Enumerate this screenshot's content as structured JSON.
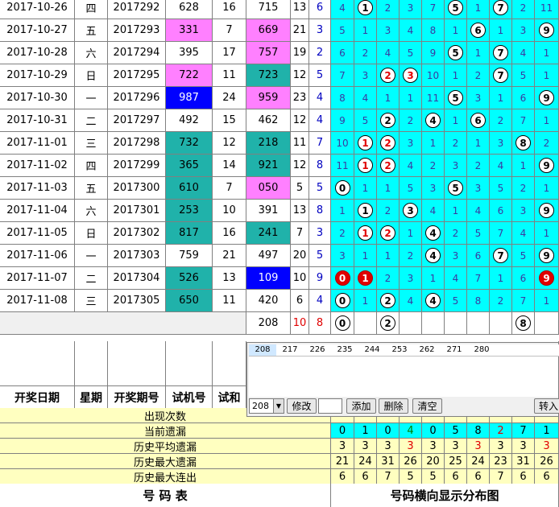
{
  "rows": [
    {
      "date": "2017-10-26",
      "wd": "四",
      "issue": "2017292",
      "test": "628",
      "tbg": "",
      "sum": "16",
      "kj": "715",
      "kbg": "",
      "s": "13",
      "sp": "6",
      "cells": [
        "4",
        "1",
        "2",
        "3",
        "7",
        "5",
        "1",
        "7",
        "2",
        "11"
      ]
    },
    {
      "date": "2017-10-27",
      "wd": "五",
      "issue": "2017293",
      "test": "331",
      "tbg": "pink",
      "sum": "7",
      "kj": "669",
      "kbg": "pink",
      "s": "21",
      "sp": "3",
      "cells": [
        "5",
        "1",
        "3",
        "4",
        "8",
        "1",
        "6",
        "1",
        "3",
        "9"
      ]
    },
    {
      "date": "2017-10-28",
      "wd": "六",
      "issue": "2017294",
      "test": "395",
      "tbg": "",
      "sum": "17",
      "kj": "757",
      "kbg": "pink",
      "s": "19",
      "sp": "2",
      "cells": [
        "6",
        "2",
        "4",
        "5",
        "9",
        "5",
        "1",
        "7",
        "4",
        "1"
      ]
    },
    {
      "date": "2017-10-29",
      "wd": "日",
      "issue": "2017295",
      "test": "722",
      "tbg": "pink",
      "sum": "11",
      "kj": "723",
      "kbg": "teal",
      "s": "12",
      "sp": "5",
      "cells": [
        "7",
        "3",
        "2",
        "3",
        "10",
        "1",
        "2",
        "7",
        "5",
        "1"
      ]
    },
    {
      "date": "2017-10-30",
      "wd": "一",
      "issue": "2017296",
      "test": "987",
      "tbg": "blue",
      "sum": "24",
      "kj": "959",
      "kbg": "pink",
      "s": "23",
      "sp": "4",
      "cells": [
        "8",
        "4",
        "1",
        "1",
        "11",
        "5",
        "3",
        "1",
        "6",
        "9"
      ]
    },
    {
      "date": "2017-10-31",
      "wd": "二",
      "issue": "2017297",
      "test": "492",
      "tbg": "",
      "sum": "15",
      "kj": "462",
      "kbg": "",
      "s": "12",
      "sp": "4",
      "cells": [
        "9",
        "5",
        "2",
        "2",
        "4",
        "1",
        "6",
        "2",
        "7",
        "1"
      ]
    },
    {
      "date": "2017-11-01",
      "wd": "三",
      "issue": "2017298",
      "test": "732",
      "tbg": "teal",
      "sum": "12",
      "kj": "218",
      "kbg": "teal",
      "s": "11",
      "sp": "7",
      "cells": [
        "10",
        "1",
        "2",
        "3",
        "1",
        "2",
        "1",
        "3",
        "8",
        "2"
      ]
    },
    {
      "date": "2017-11-02",
      "wd": "四",
      "issue": "2017299",
      "test": "365",
      "tbg": "teal",
      "sum": "14",
      "kj": "921",
      "kbg": "teal",
      "s": "12",
      "sp": "8",
      "cells": [
        "11",
        "1",
        "2",
        "4",
        "2",
        "3",
        "2",
        "4",
        "1",
        "9"
      ]
    },
    {
      "date": "2017-11-03",
      "wd": "五",
      "issue": "2017300",
      "test": "610",
      "tbg": "teal",
      "sum": "7",
      "kj": "050",
      "kbg": "pink",
      "s": "5",
      "sp": "5",
      "cells": [
        "0",
        "1",
        "1",
        "5",
        "3",
        "5",
        "3",
        "5",
        "2",
        "1"
      ]
    },
    {
      "date": "2017-11-04",
      "wd": "六",
      "issue": "2017301",
      "test": "253",
      "tbg": "teal",
      "sum": "10",
      "kj": "391",
      "kbg": "",
      "s": "13",
      "sp": "8",
      "cells": [
        "1",
        "1",
        "2",
        "3",
        "4",
        "1",
        "4",
        "6",
        "3",
        "9"
      ]
    },
    {
      "date": "2017-11-05",
      "wd": "日",
      "issue": "2017302",
      "test": "817",
      "tbg": "teal",
      "sum": "16",
      "kj": "241",
      "kbg": "teal",
      "s": "7",
      "sp": "3",
      "cells": [
        "2",
        "1",
        "2",
        "1",
        "4",
        "2",
        "5",
        "7",
        "4",
        "1"
      ]
    },
    {
      "date": "2017-11-06",
      "wd": "一",
      "issue": "2017303",
      "test": "759",
      "tbg": "",
      "sum": "21",
      "kj": "497",
      "kbg": "",
      "s": "20",
      "sp": "5",
      "cells": [
        "3",
        "1",
        "1",
        "2",
        "4",
        "3",
        "6",
        "7",
        "5",
        "9"
      ]
    },
    {
      "date": "2017-11-07",
      "wd": "二",
      "issue": "2017304",
      "test": "526",
      "tbg": "teal",
      "sum": "13",
      "kj": "109",
      "kbg": "blue",
      "s": "10",
      "sp": "9",
      "cells": [
        "0",
        "1",
        "2",
        "3",
        "1",
        "4",
        "7",
        "1",
        "6",
        "9"
      ]
    },
    {
      "date": "2017-11-08",
      "wd": "三",
      "issue": "2017305",
      "test": "650",
      "tbg": "teal",
      "sum": "11",
      "kj": "420",
      "kbg": "",
      "s": "6",
      "sp": "4",
      "cells": [
        "0",
        "1",
        "2",
        "4",
        "4",
        "5",
        "8",
        "2",
        "7",
        "1"
      ]
    }
  ],
  "ball_map": [
    [
      1,
      5,
      7
    ],
    [
      6,
      9
    ],
    [
      5,
      7
    ],
    [
      2,
      3,
      7
    ],
    [
      5,
      9
    ],
    [
      2,
      4,
      6
    ],
    [
      1,
      2,
      8
    ],
    [
      1,
      2,
      9
    ],
    [
      0,
      5
    ],
    [
      1,
      3,
      9
    ],
    [
      1,
      2,
      4
    ],
    [
      4,
      7,
      9
    ],
    [
      0,
      1,
      9
    ],
    [
      0,
      2,
      4
    ]
  ],
  "red_map": [
    [],
    [],
    [],
    [
      2,
      3
    ],
    [],
    [],
    [
      1,
      2
    ],
    [
      1,
      2
    ],
    [],
    [],
    [
      1,
      2
    ],
    [],
    [],
    []
  ],
  "solid_map": [
    [],
    [],
    [],
    [],
    [],
    [],
    [],
    [],
    [],
    [],
    [],
    [],
    [
      0,
      1,
      9
    ],
    []
  ],
  "predict": {
    "kj": "208",
    "s": "10",
    "sp": "8",
    "balls": [
      "0",
      "2",
      "8"
    ]
  },
  "headers": {
    "date": "开奖日期",
    "wd": "星期",
    "issue": "开奖期号",
    "test": "试机号",
    "sum": "试和"
  },
  "stats": {
    "labels": [
      "出现次数",
      "当前遗漏",
      "历史平均遗漏",
      "历史最大遗漏",
      "历史最大连出"
    ],
    "current": [
      "0",
      "1",
      "0",
      "4",
      "0",
      "5",
      "8",
      "2",
      "7",
      "1"
    ],
    "avg": [
      "3",
      "3",
      "3",
      "3",
      "3",
      "3",
      "3",
      "3",
      "3",
      "3"
    ],
    "max": [
      "21",
      "24",
      "31",
      "26",
      "20",
      "25",
      "24",
      "23",
      "31",
      "26"
    ],
    "maxrun": [
      "6",
      "6",
      "7",
      "5",
      "5",
      "6",
      "6",
      "7",
      "6",
      "6"
    ]
  },
  "footer": {
    "left": "号  码  表",
    "right": "号码横向显示分布图"
  },
  "dialog": {
    "list": [
      "208",
      "217",
      "226",
      "235",
      "244",
      "253",
      "262",
      "271",
      "280"
    ],
    "combo": "208",
    "buttons": {
      "modify": "修改",
      "add": "添加",
      "delete": "删除",
      "clear": "清空",
      "import": "转入"
    }
  }
}
